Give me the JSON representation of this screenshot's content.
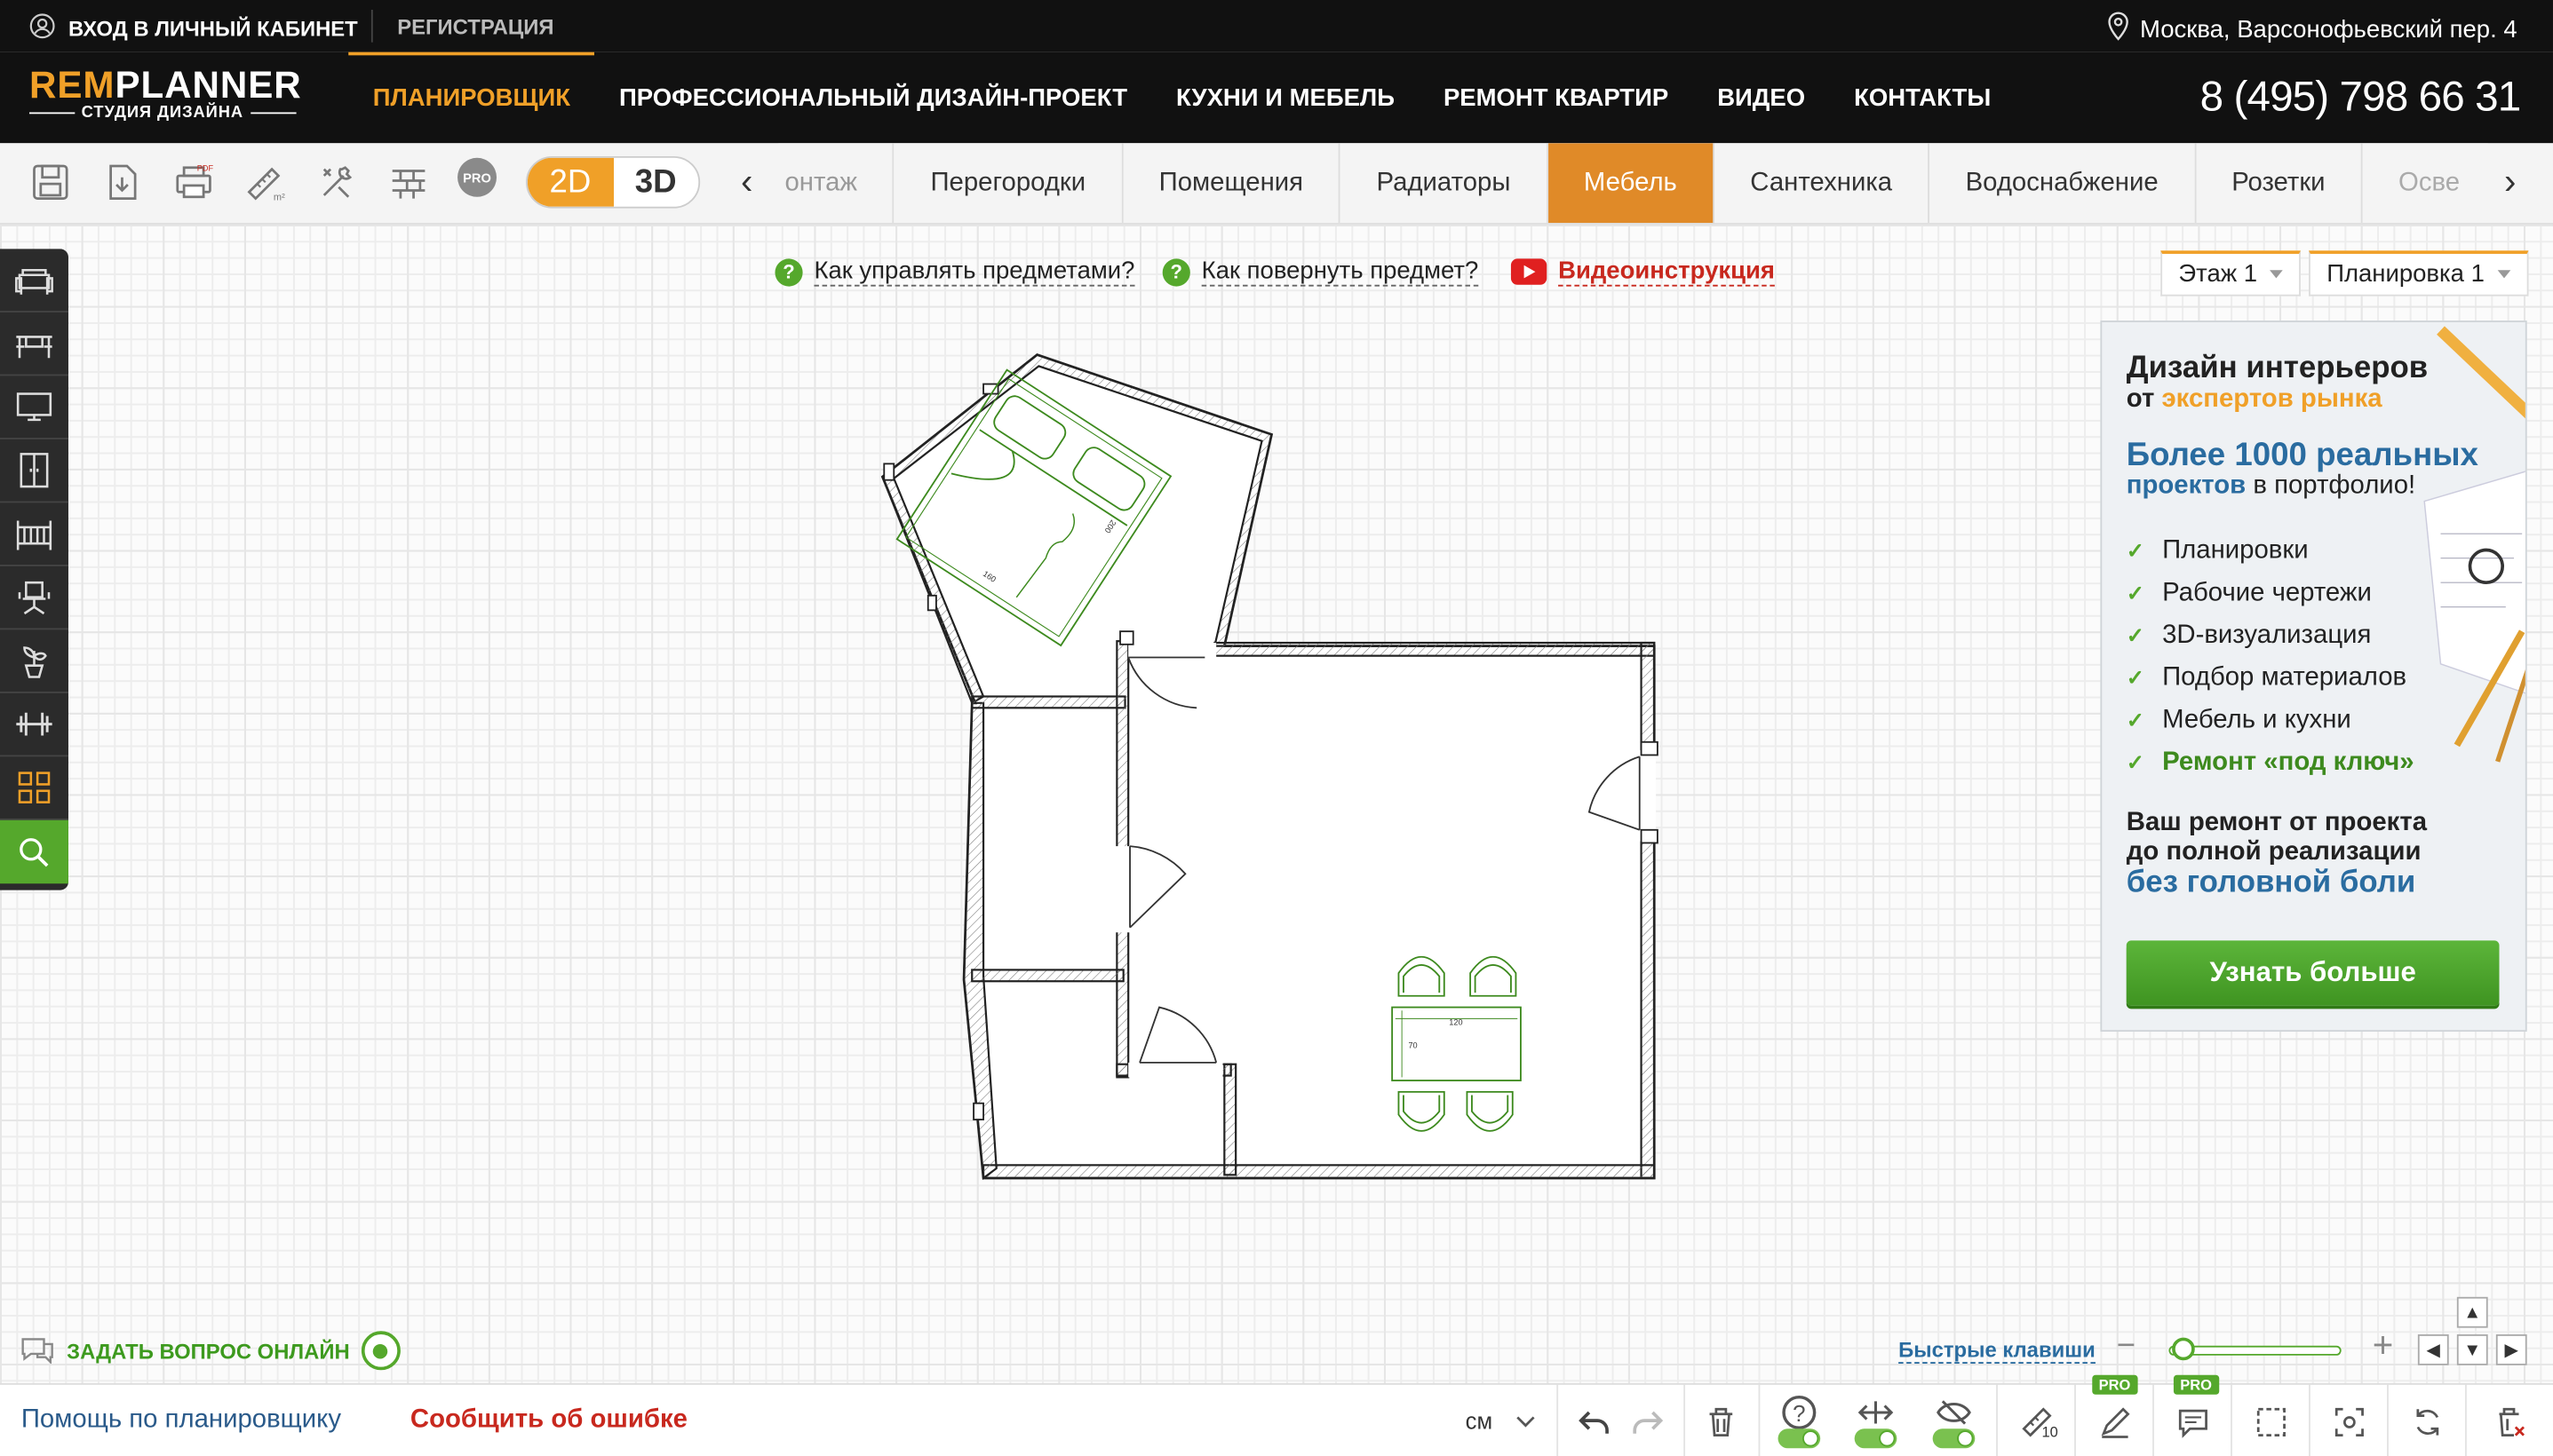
{
  "topbar": {
    "login": "ВХОД В ЛИЧНЫЙ КАБИНЕТ",
    "register": "РЕГИСТРАЦИЯ",
    "address": "Москва, Варсонофьевский пер. 4"
  },
  "logo": {
    "part1": "REM",
    "part2": "PLANNER",
    "subtitle": "СТУДИЯ ДИЗАЙНА"
  },
  "nav": {
    "items": [
      "ПЛАНИРОВЩИК",
      "ПРОФЕССИОНАЛЬНЫЙ ДИЗАЙН-ПРОЕКТ",
      "КУХНИ И МЕБЕЛЬ",
      "РЕМОНТ КВАРТИР",
      "ВИДЕО",
      "КОНТАКТЫ"
    ],
    "active": "ПЛАНИРОВЩИК",
    "phone": "8 (495) 798 66 31"
  },
  "toolbar": {
    "pro_badge": "PRO",
    "mode_2d": "2D",
    "mode_3d": "3D",
    "categories": [
      "онтаж",
      "Перегородки",
      "Помещения",
      "Радиаторы",
      "Мебель",
      "Сантехника",
      "Водоснабжение",
      "Розетки",
      "Осве"
    ],
    "active_category": "Мебель"
  },
  "help": {
    "manage": "Как управлять предметами?",
    "rotate": "Как повернуть предмет?",
    "video": "Видеоинструкция"
  },
  "selectors": {
    "floor": "Этаж 1",
    "layout": "Планировка 1"
  },
  "ad": {
    "title": "Дизайн интерьеров",
    "subtitle_prefix": "от",
    "subtitle_accent": "экспертов рынка",
    "headline": "Более 1000 реальных",
    "headline2_bold": "проектов",
    "headline2_rest": "в портфолио!",
    "list": [
      "Планировки",
      "Рабочие чертежи",
      "3D-визуализация",
      "Подбор материалов",
      "Мебель и кухни",
      "Ремонт «под ключ»"
    ],
    "footer1": "Ваш ремонт от проекта",
    "footer2": "до полной реализации",
    "footer3": "без головной боли",
    "button": "Узнать больше"
  },
  "plan": {
    "table_width": "120",
    "table_depth": "70",
    "bed_width": "160",
    "bed_length": "200"
  },
  "bottom": {
    "ask": "ЗАДАТЬ ВОПРОС ОНЛАЙН",
    "hotkeys": "Быстрые клавиши",
    "help_link": "Помощь по планировщику",
    "report_link": "Сообщить об ошибке",
    "unit": "см",
    "pro1": "PRO",
    "pro2": "PRO",
    "ruler_label": "10"
  },
  "colors": {
    "accent": "#f0a028",
    "green": "#55a82c",
    "red": "#c8281e",
    "blue": "#2a6ca0"
  }
}
